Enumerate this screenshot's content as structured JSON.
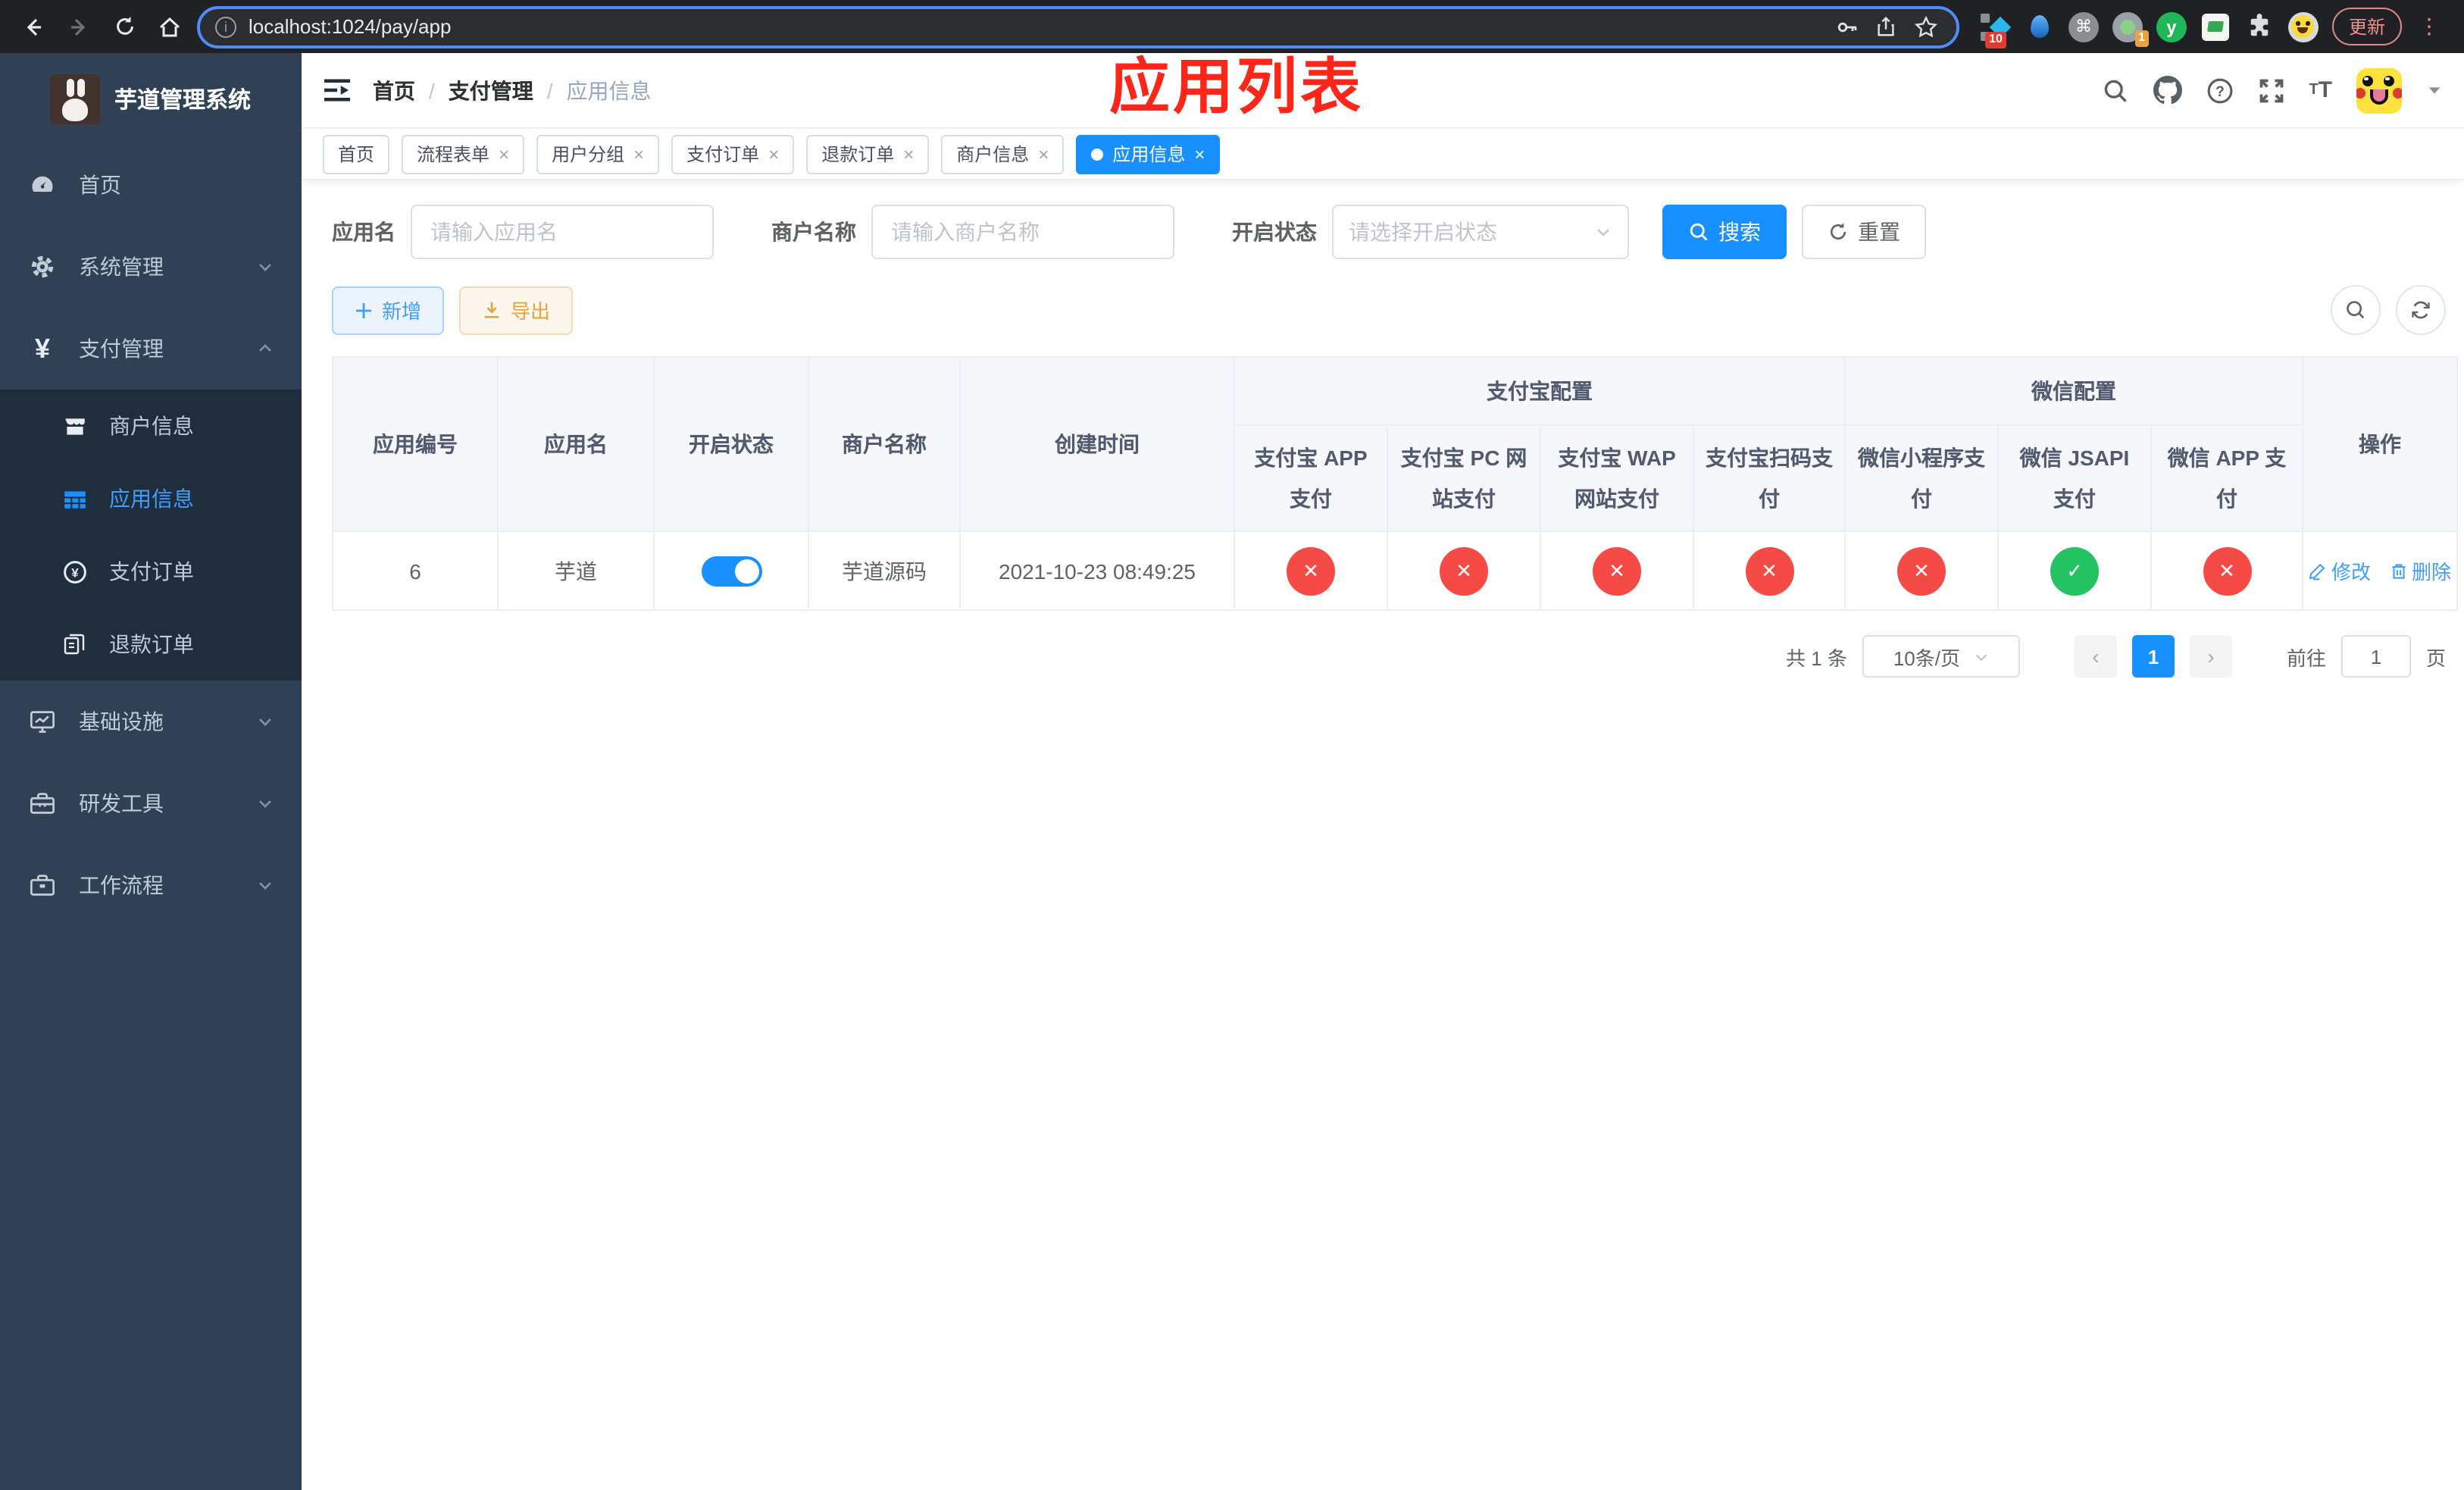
{
  "colors": {
    "primary": "#1890ff",
    "link": "#409eff",
    "danger": "#f54a45",
    "success": "#23c361",
    "warning": "#e6a23c",
    "annotation_red": "#fe2619",
    "sidebar_bg": "#304156",
    "submenu_bg": "#1f2d3d"
  },
  "browser": {
    "url": "localhost:1024/pay/app",
    "update_label": "更新",
    "ext_badge_pin": "10",
    "ext_badge_rec": "1",
    "ext_y_label": "y"
  },
  "sidebar": {
    "title": "芋道管理系统",
    "items": [
      {
        "label": "首页",
        "expandable": false
      },
      {
        "label": "系统管理",
        "expandable": true,
        "expanded": false
      },
      {
        "label": "支付管理",
        "expandable": true,
        "expanded": true
      },
      {
        "label": "基础设施",
        "expandable": true,
        "expanded": false
      },
      {
        "label": "研发工具",
        "expandable": true,
        "expanded": false
      },
      {
        "label": "工作流程",
        "expandable": true,
        "expanded": false
      }
    ],
    "submenu": [
      {
        "label": "商户信息",
        "active": false
      },
      {
        "label": "应用信息",
        "active": true
      },
      {
        "label": "支付订单",
        "active": false
      },
      {
        "label": "退款订单",
        "active": false
      }
    ],
    "pay_icon_glyph": "¥"
  },
  "navbar": {
    "breadcrumbs": [
      "首页",
      "支付管理",
      "应用信息"
    ],
    "separator": "/",
    "annotation": "应用列表"
  },
  "tabs": [
    {
      "label": "首页",
      "closable": false,
      "active": false
    },
    {
      "label": "流程表单",
      "closable": true,
      "active": false
    },
    {
      "label": "用户分组",
      "closable": true,
      "active": false
    },
    {
      "label": "支付订单",
      "closable": true,
      "active": false
    },
    {
      "label": "退款订单",
      "closable": true,
      "active": false
    },
    {
      "label": "商户信息",
      "closable": true,
      "active": false
    },
    {
      "label": "应用信息",
      "closable": true,
      "active": true
    }
  ],
  "tabs_meta": {
    "close_glyph": "×"
  },
  "filters": {
    "app_name_label": "应用名",
    "app_name_placeholder": "请输入应用名",
    "merchant_label": "商户名称",
    "merchant_placeholder": "请输入商户名称",
    "status_label": "开启状态",
    "status_placeholder": "请选择开启状态",
    "search_label": "搜索",
    "reset_label": "重置"
  },
  "toolbar": {
    "add_label": "新增",
    "export_label": "导出"
  },
  "table": {
    "main_columns": [
      "应用编号",
      "应用名",
      "开启状态",
      "商户名称",
      "创建时间"
    ],
    "groups": [
      {
        "label": "支付宝配置"
      },
      {
        "label": "微信配置"
      }
    ],
    "sub_columns": [
      "支付宝 APP 支付",
      "支付宝 PC 网站支付",
      "支付宝 WAP 网站支付",
      "支付宝扫码支付",
      "微信小程序支付",
      "微信 JSAPI 支付",
      "微信 APP 支付"
    ],
    "action_column": "操作",
    "rows": [
      {
        "id": "6",
        "name": "芋道",
        "enabled": true,
        "merchant": "芋道源码",
        "created_at": "2021-10-23 08:49:25",
        "gateways": [
          {
            "name": "支付宝 APP 支付",
            "enabled": false,
            "glyph": "✕",
            "color": "#f54a45"
          },
          {
            "name": "支付宝 PC 网站支付",
            "enabled": false,
            "glyph": "✕",
            "color": "#f54a45"
          },
          {
            "name": "支付宝 WAP 网站支付",
            "enabled": false,
            "glyph": "✕",
            "color": "#f54a45"
          },
          {
            "name": "支付宝扫码支付",
            "enabled": false,
            "glyph": "✕",
            "color": "#f54a45"
          },
          {
            "name": "微信小程序支付",
            "enabled": false,
            "glyph": "✕",
            "color": "#f54a45"
          },
          {
            "name": "微信 JSAPI 支付",
            "enabled": true,
            "glyph": "✓",
            "color": "#23c361"
          },
          {
            "name": "微信 APP 支付",
            "enabled": false,
            "glyph": "✕",
            "color": "#f54a45"
          }
        ],
        "edit_label": "修改",
        "delete_label": "删除"
      }
    ]
  },
  "pagination": {
    "total": "共 1 条",
    "page_size": "10条/页",
    "prev_glyph": "‹",
    "page": "1",
    "next_glyph": "›",
    "goto_label": "前往",
    "goto_value": "1",
    "unit_label": "页"
  }
}
